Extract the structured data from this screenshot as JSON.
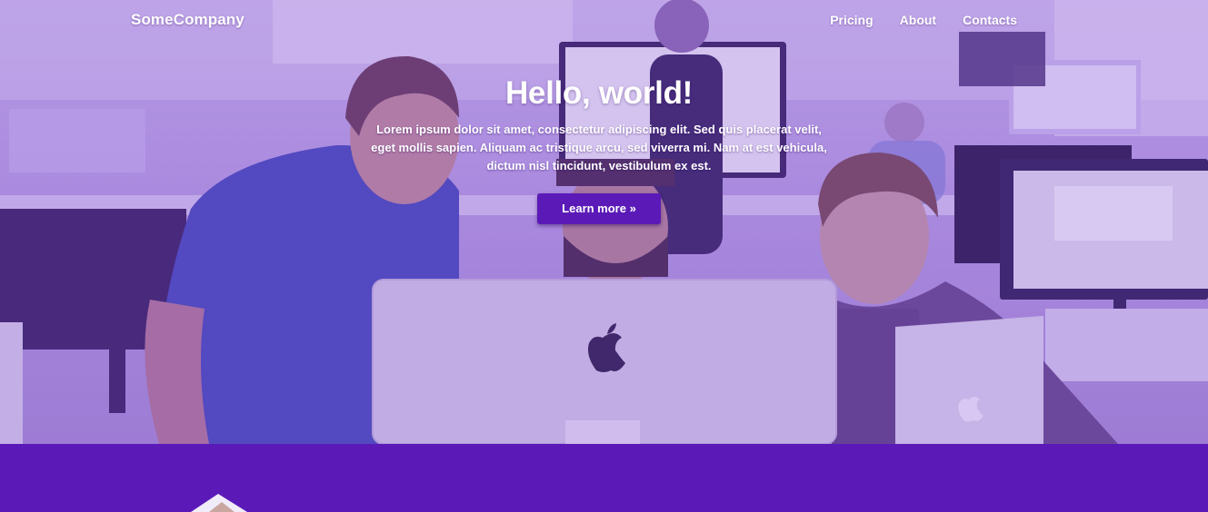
{
  "navbar": {
    "brand": "SomeCompany",
    "links": [
      {
        "label": "Pricing"
      },
      {
        "label": "About"
      },
      {
        "label": "Contacts"
      }
    ]
  },
  "hero": {
    "title": "Hello, world!",
    "description": "Lorem ipsum dolor sit amet, consectetur adipiscing elit. Sed quis placerat velit, eget mollis sapien. Aliquam ac tristique arcu, sed viverra mi. Nam at est vehicula, dictum nisl tincidunt, vestibulum ex est.",
    "button_label": "Learn more »"
  },
  "colors": {
    "accent": "#5b1ab8",
    "hero_tint": "#b89fe0",
    "text": "#ffffff"
  }
}
